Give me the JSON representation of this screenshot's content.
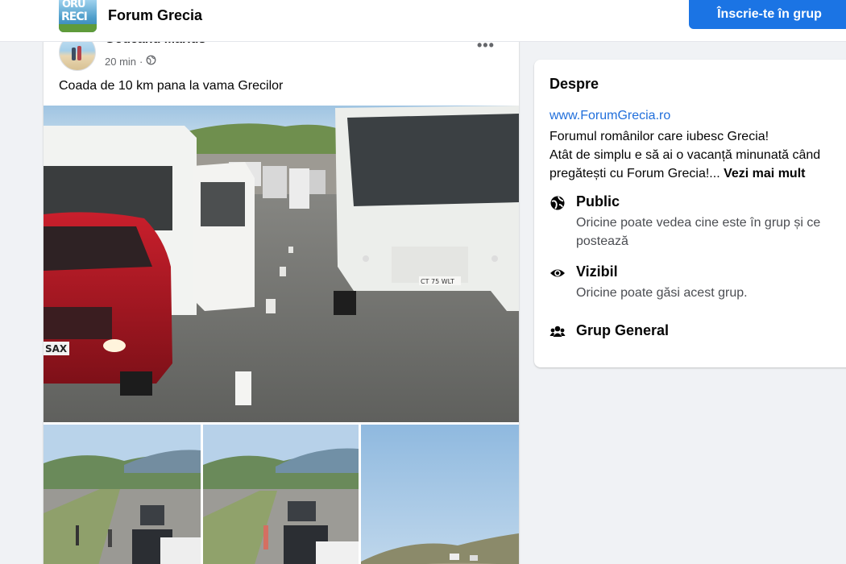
{
  "header": {
    "group_name": "Forum Grecia",
    "logo_text_top": "ORU",
    "logo_text_bottom": "RECI",
    "join_label": "Înscrie-te în grup",
    "accent": "#1b74e4"
  },
  "post": {
    "author": "Godeanu Marius",
    "time": "20 min",
    "time_separator": "·",
    "privacy_icon": "globe-icon",
    "more_icon": "more-options-icon",
    "text": "Coada de 10 km pana la vama Grecilor",
    "plate_main": "SAX",
    "plate_bus": "CT 75 WLT",
    "photos": [
      "main-photo",
      "thumb-photo-1",
      "thumb-photo-2",
      "thumb-photo-3"
    ]
  },
  "about": {
    "title": "Despre",
    "link": "www.ForumGrecia.ro",
    "desc_line1": "Forumul românilor care iubesc Grecia!",
    "desc_line2": "Atât de simplu e să ai o vacanță minunată când",
    "desc_line3": "pregătești cu Forum Grecia!...",
    "see_more": "Vezi mai mult",
    "items": [
      {
        "icon": "globe-icon",
        "label": "Public",
        "sub": "Oricine poate vedea cine este în grup și ce postează"
      },
      {
        "icon": "eye-icon",
        "label": "Vizibil",
        "sub": "Oricine poate găsi acest grup."
      },
      {
        "icon": "people-icon",
        "label": "Grup General",
        "sub": ""
      }
    ]
  }
}
